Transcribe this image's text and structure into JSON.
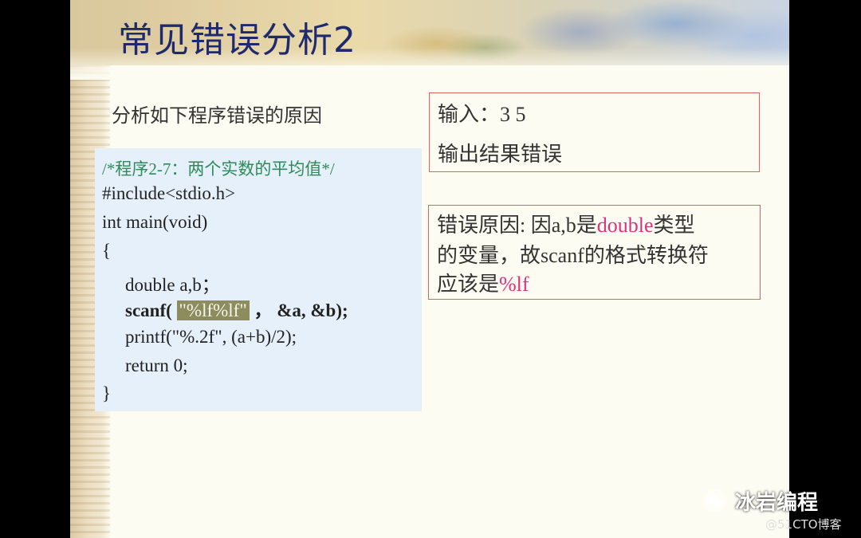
{
  "slide": {
    "title": "常见错误分析2",
    "subtitle": "分析如下程序错误的原因"
  },
  "code": {
    "comment": "/*程序2-7：两个实数的平均值*/",
    "include": "#include<stdio.h>",
    "main_decl": "int main(void)",
    "open_brace": "{",
    "declaration": "double a,b；",
    "scanf_prefix": "scanf(",
    "scanf_format": "\"%lf%lf\"",
    "scanf_suffix": "，  &a, &b);",
    "printf_line": "printf(\"%.2f\", (a+b)/2);",
    "return_line": "return 0;",
    "close_brace": "}"
  },
  "input_box": {
    "line1": "输入：3 5",
    "line2": "输出结果错误"
  },
  "reason_box": {
    "part1": "错误原因: 因a,b是",
    "highlight1": "double",
    "part2": "类型",
    "line2": "的变量，故scanf的格式转换符",
    "part3": "应该是",
    "highlight2": "%lf"
  },
  "colors": {
    "title": "#1e2a6e",
    "comment": "#2e8b57",
    "highlight_pink": "#e0307a",
    "box_border": "#e36060",
    "code_bg": "#e6f0fb"
  },
  "watermark": {
    "icon": "wechat-icon",
    "text": "冰岩编程",
    "source": "@51CTO博客"
  }
}
